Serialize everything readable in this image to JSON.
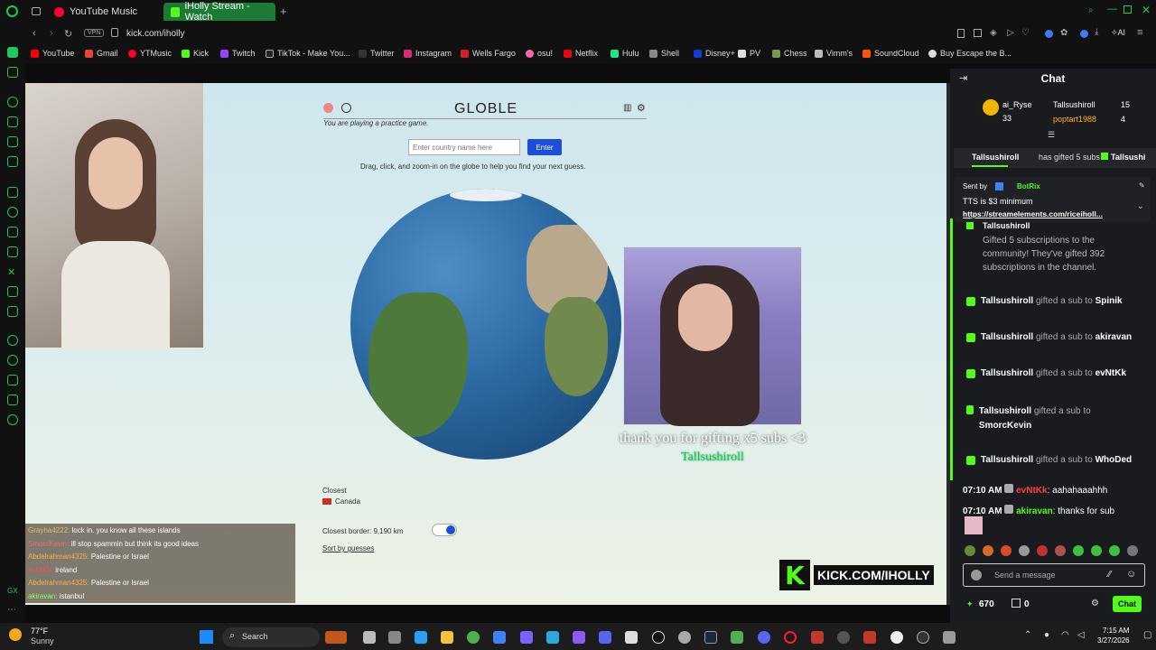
{
  "browser": {
    "tabs": [
      {
        "label": "YouTube Music",
        "color": "#ff0033"
      },
      {
        "label": "iHolly Stream - Watch",
        "color": "#53fc18"
      }
    ],
    "url": "kick.com/iholly",
    "vpn_label": "VPN",
    "ai_label": "AI",
    "bookmarks": [
      "YouTube",
      "Gmail",
      "YTMusic",
      "Kick",
      "Twitch",
      "TikTok - Make You...",
      "Twitter",
      "Instagram",
      "Wells Fargo",
      "osu!",
      "Netflix",
      "Hulu",
      "Shell",
      "Disney+",
      "PV",
      "Chess",
      "Vimm's",
      "SoundCloud",
      "Buy Escape the B..."
    ]
  },
  "game": {
    "title": "GLOBLE",
    "practice_note": "You are playing a practice game.",
    "input_placeholder": "Enter country name here",
    "enter_label": "Enter",
    "instructions": "Drag, click, and zoom-in on the globe to help you find your next guess.",
    "closest_label": "Closest",
    "closest_country": "Canada",
    "closest_border": "Closest border: 9,190  km",
    "sort_label": "Sort by guesses"
  },
  "alert": {
    "message": "thank you for gifting x5 subs <3",
    "name": "Tallsushiroll"
  },
  "overlay_chat": [
    {
      "user": "Grayha4222:",
      "text": "lock in. you know all these islands",
      "color": "#e0c060"
    },
    {
      "user": "SmorcKevin:",
      "text": "ill stop spammin but think its good ideas",
      "color": "#ff6a6a"
    },
    {
      "user": "Abdelrahman4325:",
      "text": "Palestine or Israel",
      "color": "#ffb040"
    },
    {
      "user": "evNtKk:",
      "text": "ireland",
      "color": "#ff5050"
    },
    {
      "user": "Abdelrahman4325:",
      "text": "Palestine or Israel",
      "color": "#ffb040"
    },
    {
      "user": "akiravan:",
      "text": "istanbul",
      "color": "#8cff60"
    }
  ],
  "kick_logo": {
    "k": "K",
    "text": "KICK.COM/IHOLLY"
  },
  "chat": {
    "title": "Chat",
    "leaders": [
      {
        "name": "ai_Ryse",
        "count": "33"
      },
      {
        "name": "Tallsushiroll",
        "count": "15"
      },
      {
        "name": "poptart1988",
        "count": "4"
      }
    ],
    "banner": {
      "name": "Tallsushiroll",
      "text": "has gifted 5 subs",
      "trail": "Tallsushi"
    },
    "pinned": {
      "sent_by_label": "Sent by",
      "sender": "BotRix",
      "text": "TTS is $3 minimum",
      "link": "https://streamelements.com/riceiholl..."
    },
    "gift_block": {
      "name": "Tallsushiroll",
      "text": "Gifted 5 subscriptions to the community! They've gifted 392 subscriptions in the channel."
    },
    "gifts": [
      {
        "from": "Tallsushiroll",
        "verb": "gifted a sub to",
        "to": "Spinik"
      },
      {
        "from": "Tallsushiroll",
        "verb": "gifted a sub to",
        "to": "akiravan"
      },
      {
        "from": "Tallsushiroll",
        "verb": "gifted a sub to",
        "to": "evNtKk"
      },
      {
        "from": "Tallsushiroll",
        "verb": "gifted a sub to",
        "to": "SmorcKevin"
      },
      {
        "from": "Tallsushiroll",
        "verb": "gifted a sub to",
        "to": "WhoDed"
      }
    ],
    "messages": [
      {
        "time": "07:10 AM",
        "user": "evNtKk",
        "text": "aahahaaahhh",
        "color": "#ff4040"
      },
      {
        "time": "07:10 AM",
        "user": "akiravan",
        "text": "thanks for sub",
        "color": "#53fc18"
      }
    ],
    "input_placeholder": "Send a message",
    "points": "670",
    "gifts_count": "0",
    "send_label": "Chat"
  },
  "taskbar": {
    "temp": "77°F",
    "weather": "Sunny",
    "search_label": "Search",
    "time": "7:15 AM",
    "date": "3/27/2026"
  }
}
